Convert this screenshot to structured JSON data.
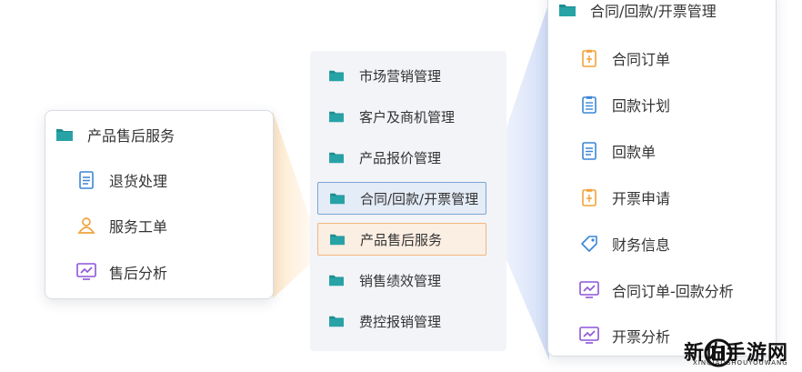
{
  "left_panel": {
    "header": "产品售后服务",
    "items": [
      {
        "label": "退货处理",
        "icon": "document-icon"
      },
      {
        "label": "服务工单",
        "icon": "person-icon"
      },
      {
        "label": "售后分析",
        "icon": "monitor-chart-icon"
      }
    ]
  },
  "mid_panel": {
    "items": [
      {
        "label": "市场营销管理"
      },
      {
        "label": "客户及商机管理"
      },
      {
        "label": "产品报价管理"
      },
      {
        "label": "合同/回款/开票管理",
        "state": "active-blue"
      },
      {
        "label": "产品售后服务",
        "state": "active-orange"
      },
      {
        "label": "销售绩效管理"
      },
      {
        "label": "费控报销管理"
      }
    ]
  },
  "right_panel": {
    "header": "合同/回款/开票管理",
    "items": [
      {
        "label": "合同订单",
        "icon": "clipboard-icon"
      },
      {
        "label": "回款计划",
        "icon": "clipboard-icon"
      },
      {
        "label": "回款单",
        "icon": "document-icon"
      },
      {
        "label": "开票申请",
        "icon": "clipboard-icon"
      },
      {
        "label": "财务信息",
        "icon": "tag-icon"
      },
      {
        "label": "合同订单-回款分析",
        "icon": "monitor-chart-icon"
      },
      {
        "label": "开票分析",
        "icon": "monitor-chart-icon"
      }
    ]
  },
  "watermark": {
    "text": "新佐手游网",
    "sub": "XINQIAOSHOUYOUWANG"
  },
  "colors": {
    "folder_teal": "#1e8c8f",
    "blue_icon": "#3a86d6",
    "orange_icon": "#f2a33a",
    "purple_icon": "#8d55d8",
    "active_blue_border": "#7ea4d6",
    "active_orange_border": "#f2b77a"
  }
}
